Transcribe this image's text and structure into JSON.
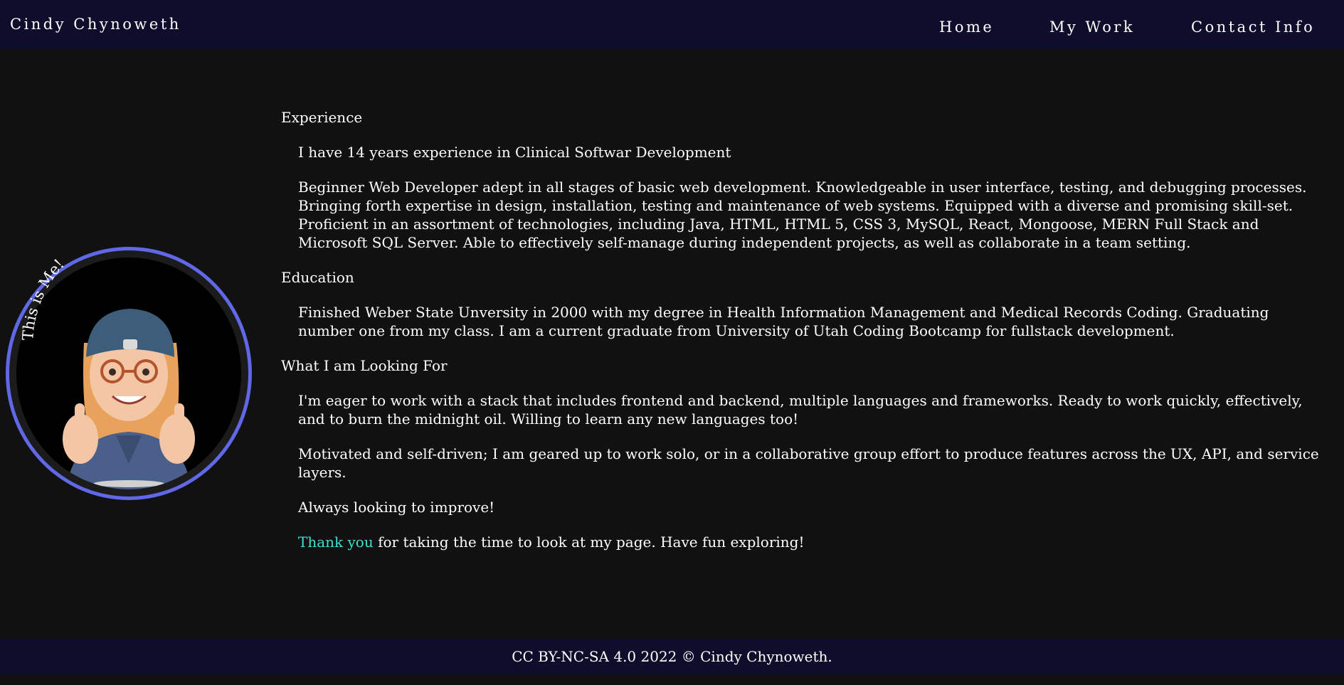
{
  "header": {
    "brand": "Cindy Chynoweth",
    "nav": [
      {
        "label": "Home"
      },
      {
        "label": "My Work"
      },
      {
        "label": "Contact Info"
      }
    ]
  },
  "avatar": {
    "caption": "This is Me!",
    "ring_color": "#6068e6"
  },
  "sections": {
    "experience": {
      "heading": "Experience",
      "p1": "I have 14 years experience in Clinical Softwar Development",
      "p2": "Beginner Web Developer adept in all stages of basic web development. Knowledgeable in user interface, testing, and debugging processes. Bringing forth expertise in design, installation, testing and maintenance of web systems. Equipped with a diverse and promising skill-set. Proficient in an assortment of technologies, including Java, HTML, HTML 5, CSS 3, MySQL, React, Mongoose, MERN Full Stack and Microsoft SQL Server. Able to effectively self-manage during independent projects, as well as collaborate in a team setting."
    },
    "education": {
      "heading": "Education",
      "p1": "Finished Weber State Unversity in 2000 with my degree in Health Information Management and Medical Records Coding. Graduating number one from my class. I am a current graduate from University of Utah Coding Bootcamp for fullstack development."
    },
    "looking": {
      "heading": "What I am Looking For",
      "p1": "I'm eager to work with a stack that includes frontend and backend, multiple languages and frameworks. Ready to work quickly, effectively, and to burn the midnight oil. Willing to learn any new languages too!",
      "p2": "Motivated and self-driven; I am geared up to work solo, or in a collaborative group effort to produce features across the UX, API, and service layers.",
      "p3": "Always looking to improve!",
      "thanks_highlight": "Thank you",
      "thanks_rest": " for taking the time to look at my page. Have fun exploring!"
    }
  },
  "footer": {
    "text": "CC BY-NC-SA 4.0 2022 © Cindy Chynoweth."
  },
  "colors": {
    "header_bg": "#0e0d2c",
    "page_bg": "#111111",
    "accent": "#40e0d0"
  }
}
